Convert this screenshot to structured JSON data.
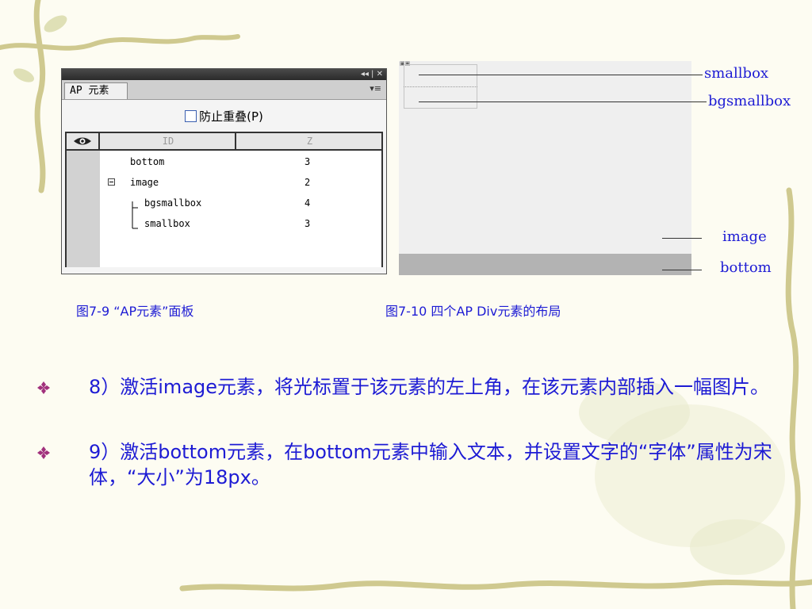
{
  "ap_panel": {
    "tab_label": "AP 元素",
    "prevent_overlap_label": "防止重叠(P)",
    "columns": {
      "id": "ID",
      "z": "Z"
    },
    "rows": [
      {
        "id": "bottom",
        "z": "3"
      },
      {
        "id": "image",
        "z": "2"
      },
      {
        "id": "bgsmallbox",
        "z": "4"
      },
      {
        "id": "smallbox",
        "z": "3"
      }
    ]
  },
  "layout_labels": {
    "smallbox": "smallbox",
    "bgsmallbox": "bgsmallbox",
    "image": "image",
    "bottom": "bottom"
  },
  "captions": {
    "fig_7_9": "图7-9 “AP元素”面板",
    "fig_7_10": "图7-10 四个AP Div元素的布局"
  },
  "bullets": [
    "8）激活image元素，将光标置于该元素的左上角，在该元素内部插入一幅图片。",
    "9）激活bottom元素，在bottom元素中输入文本，并设置文字的“字体”属性为宋体，“大小”为18px。"
  ],
  "colors": {
    "text_accent": "#1d1bd4",
    "bullet_mark": "#a1307c",
    "background": "#fdfcf2",
    "vine": "#c9c38a"
  },
  "icons": {
    "visibility": "eye-icon",
    "panel_menu": "menu-icon",
    "bullet": "diamond-bullet-icon"
  }
}
